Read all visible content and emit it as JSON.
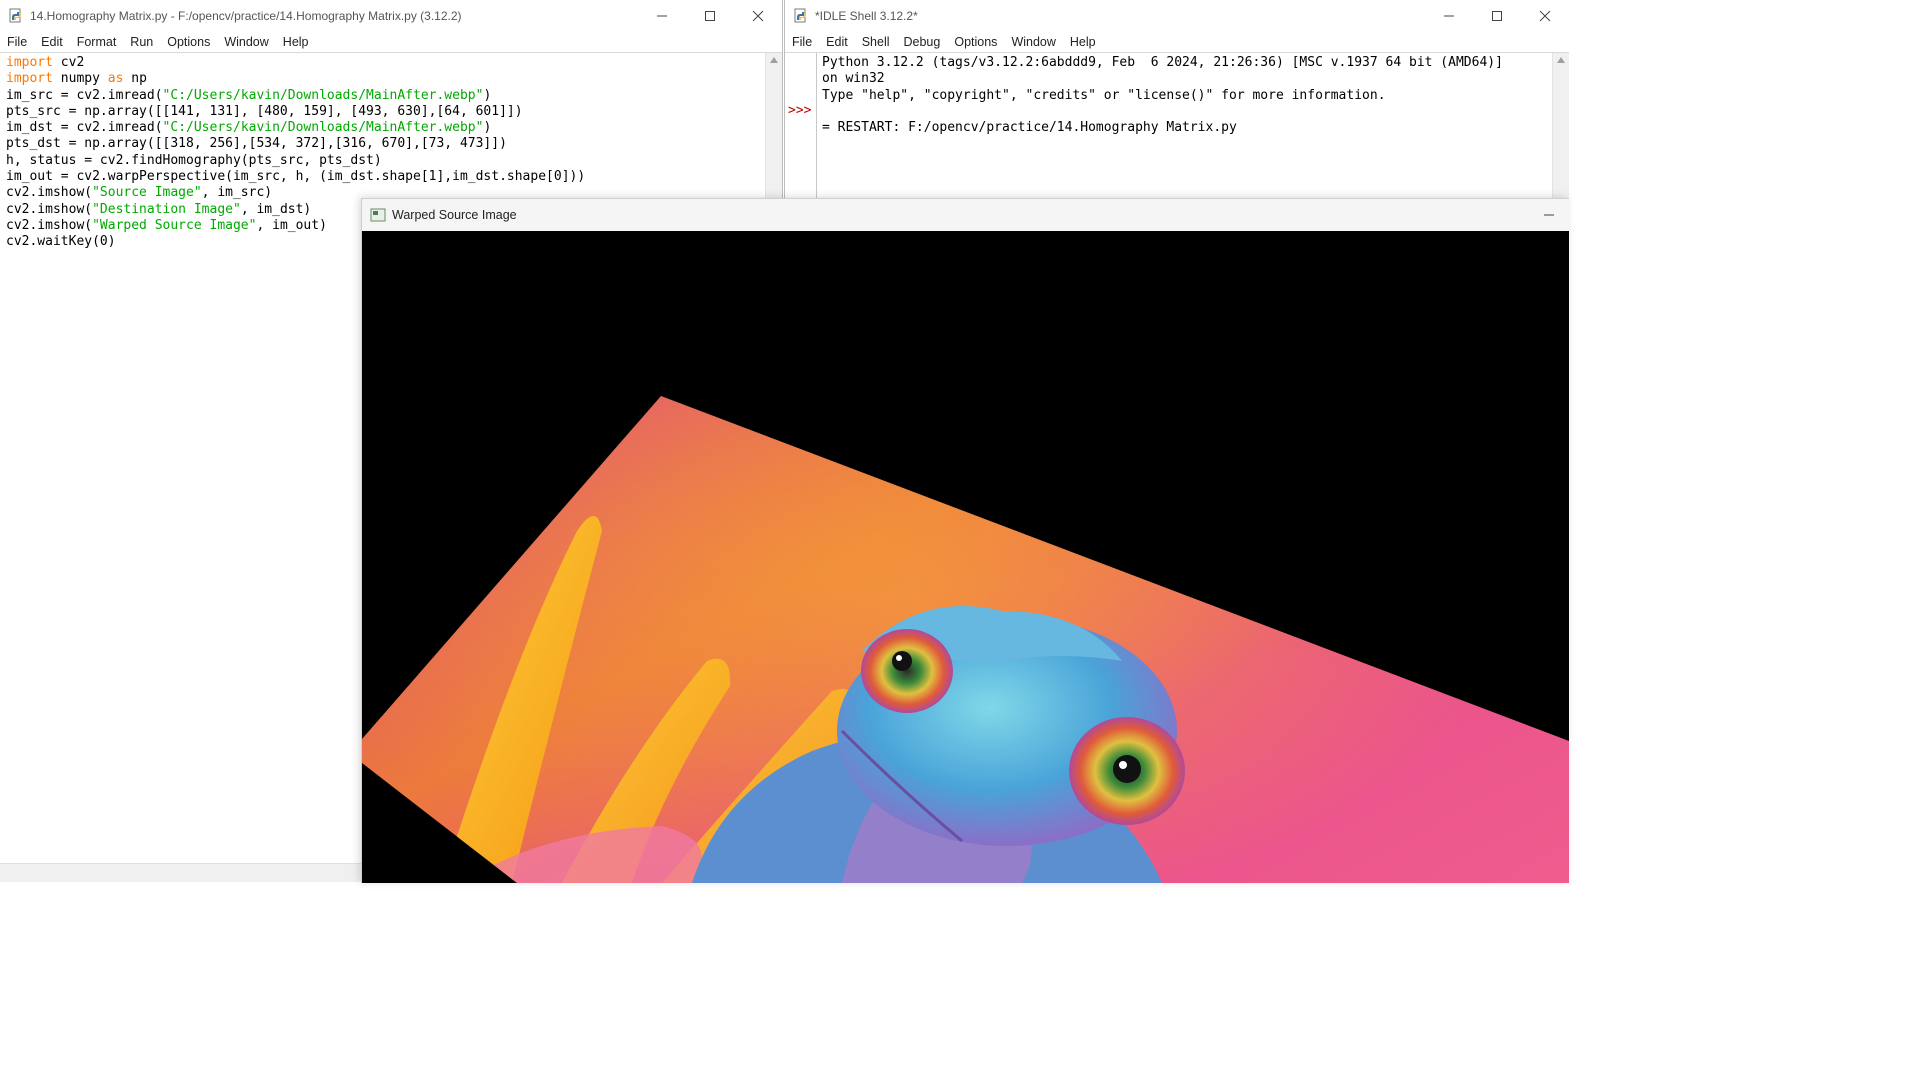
{
  "editor": {
    "title": "14.Homography Matrix.py - F:/opencv/practice/14.Homography Matrix.py (3.12.2)",
    "menus": [
      "File",
      "Edit",
      "Format",
      "Run",
      "Options",
      "Window",
      "Help"
    ],
    "code_lines": [
      [
        {
          "t": "import",
          "c": "kw"
        },
        {
          "t": " cv2"
        }
      ],
      [
        {
          "t": "import",
          "c": "kw"
        },
        {
          "t": " numpy "
        },
        {
          "t": "as",
          "c": "kw"
        },
        {
          "t": " np"
        }
      ],
      [
        {
          "t": "im_src = cv2.imread("
        },
        {
          "t": "\"C:/Users/kavin/Downloads/MainAfter.webp\"",
          "c": "st"
        },
        {
          "t": ")"
        }
      ],
      [
        {
          "t": "pts_src = np.array([[141, 131], [480, 159], [493, 630],[64, 601]])"
        }
      ],
      [
        {
          "t": "im_dst = cv2.imread("
        },
        {
          "t": "\"C:/Users/kavin/Downloads/MainAfter.webp\"",
          "c": "st"
        },
        {
          "t": ")"
        }
      ],
      [
        {
          "t": "pts_dst = np.array([[318, 256],[534, 372],[316, 670],[73, 473]])"
        }
      ],
      [
        {
          "t": "h, status = cv2.findHomography(pts_src, pts_dst)"
        }
      ],
      [
        {
          "t": "im_out = cv2.warpPerspective(im_src, h, (im_dst.shape[1],im_dst.shape[0]))"
        }
      ],
      [
        {
          "t": "cv2.imshow("
        },
        {
          "t": "\"Source Image\"",
          "c": "st"
        },
        {
          "t": ", im_src)"
        }
      ],
      [
        {
          "t": "cv2.imshow("
        },
        {
          "t": "\"Destination Image\"",
          "c": "st"
        },
        {
          "t": ", im_dst)"
        }
      ],
      [
        {
          "t": "cv2.imshow("
        },
        {
          "t": "\"Warped Source Image\"",
          "c": "st"
        },
        {
          "t": ", im_out)"
        }
      ],
      [
        {
          "t": "cv2.waitKey(0)"
        }
      ]
    ]
  },
  "shell": {
    "title": "*IDLE Shell 3.12.2*",
    "menus": [
      "File",
      "Edit",
      "Shell",
      "Debug",
      "Options",
      "Window",
      "Help"
    ],
    "prompt": ">>>",
    "lines": [
      "Python 3.12.2 (tags/v3.12.2:6abddd9, Feb  6 2024, 21:26:36) [MSC v.1937 64 bit (AMD64)]",
      "on win32",
      "Type \"help\", \"copyright\", \"credits\" or \"license()\" for more information.",
      "",
      "= RESTART: F:/opencv/practice/14.Homography Matrix.py"
    ]
  },
  "cv_window": {
    "title": "Warped Source Image"
  },
  "icons": {
    "python-file": "python-file-icon",
    "shell": "python-shell-icon",
    "opencv-window": "opencv-window-icon"
  },
  "colors": {
    "keyword": "#ff7700",
    "string": "#00aa00",
    "prompt": "#c00000"
  }
}
